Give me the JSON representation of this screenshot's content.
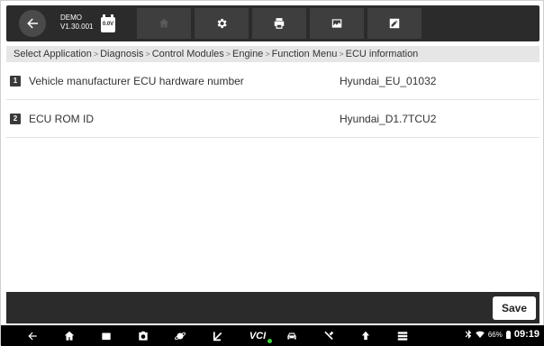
{
  "topbar": {
    "demo_title": "DEMO",
    "version": "V1.30.001",
    "voltage": "0.0V"
  },
  "breadcrumb": [
    "Select Application",
    "Diagnosis",
    "Control Modules",
    "Engine",
    "Function Menu",
    "ECU information"
  ],
  "rows": [
    {
      "index": "1",
      "label": "Vehicle manufacturer ECU hardware number",
      "value": "Hyundai_EU_01032"
    },
    {
      "index": "2",
      "label": "ECU ROM ID",
      "value": "Hyundai_D1.7TCU2"
    }
  ],
  "footer": {
    "save_label": "Save"
  },
  "status": {
    "battery": "66%",
    "time": "09:19",
    "vci_label": "VCI"
  },
  "colors": {
    "topbar": "#2b2b2b",
    "button": "#3e3e3e",
    "breadcrumb_bg": "#e6e6e6",
    "navbar": "#000000",
    "vci_dot": "#3ecf3e"
  }
}
